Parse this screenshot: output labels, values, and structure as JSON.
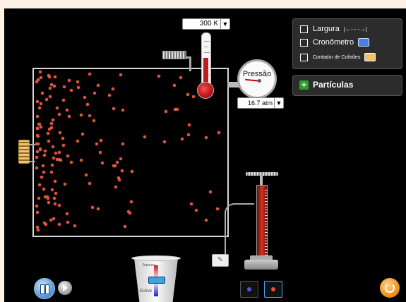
{
  "thermometer": {
    "value": "300 K",
    "arrow": "▼"
  },
  "pressure": {
    "title": "Pressão",
    "value": "16.7 atm",
    "arrow": "▼"
  },
  "options": {
    "width_label": "Largura",
    "width_icon": "|←- - -→|",
    "stopwatch_label": "Cronômetro",
    "collision_label": "Contador de Colisões"
  },
  "particles_panel": {
    "add_symbol": "+",
    "label": "Partículas"
  },
  "bucket": {
    "heat_label": "Aquecer",
    "cool_label": "Esfriar"
  },
  "colors": {
    "particle": "#e8503a",
    "accent_blue": "#4a8fe0",
    "reset_orange": "#f08a10",
    "add_green": "#2ca02c"
  },
  "icons": {
    "pause": "pause-icon",
    "step": "step-forward-icon",
    "reset": "reset-icon",
    "eraser": "eraser-icon",
    "stopwatch": "stopwatch-icon",
    "collision_counter": "counter-icon"
  }
}
